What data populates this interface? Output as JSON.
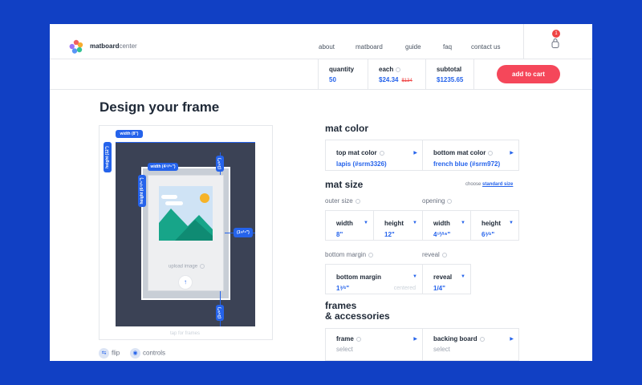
{
  "brand": {
    "bold": "matboard",
    "light": "center"
  },
  "nav": [
    "about",
    "matboard",
    "guide",
    "faq",
    "contact us"
  ],
  "cart": {
    "badge": "1",
    "icon": "shopping-bag-icon"
  },
  "order": {
    "quantity_label": "quantity",
    "quantity": "50",
    "each_label": "each",
    "each": "$24.34",
    "each_old": "$134",
    "subtotal_label": "subtotal",
    "subtotal": "$1235.65",
    "add_to_cart": "add to cart"
  },
  "page_title": "Design your frame",
  "preview": {
    "width_outer": "width (8\")",
    "height_outer": "height (12\")",
    "width_opening": "width (4¹²⁄¹⁶\")",
    "height_opening": "height (6¹²⁄¹⁶\")",
    "margin_top": "(1⁵⁄⁸\")",
    "margin_side": "(1⁵⁄¹⁶\")",
    "margin_bottom": "(1⁵⁄⁸\")",
    "upload_label": "upload image",
    "upload_btn": "↑",
    "tip": "tap for frames",
    "flip": "flip",
    "controls": "controls"
  },
  "mat_color": {
    "title": "mat color",
    "top_label": "top mat color",
    "top_value": "lapis (#srm3326)",
    "bottom_label": "bottom mat color",
    "bottom_value": "french blue (#srm972)"
  },
  "mat_size": {
    "title": "mat size",
    "choose_prefix": "choose",
    "choose_link": "standard size",
    "outer_size": "outer size",
    "opening": "opening",
    "outer_width_label": "width",
    "outer_width": "8\"",
    "outer_height_label": "height",
    "outer_height": "12\"",
    "open_width_label": "width",
    "open_width": "4¹²⁄¹⁶\"",
    "open_height_label": "height",
    "open_height": "6³⁄⁴\"",
    "bottom_margin_section": "bottom margin",
    "reveal_section": "reveal",
    "bottom_margin_label": "bottom margin",
    "bottom_margin": "1³⁄⁴\"",
    "centered": "centered",
    "reveal_label": "reveal",
    "reveal": "1/4\""
  },
  "frames": {
    "title_line1": "frames",
    "title_line2": "& accessories",
    "frame_label": "frame",
    "frame_value": "select",
    "backing_label": "backing board",
    "backing_value": "select"
  },
  "colors": {
    "accent": "#2563eb",
    "cta": "#f5475a",
    "frame": "#3b4255",
    "page_bg": "#1140c4"
  }
}
